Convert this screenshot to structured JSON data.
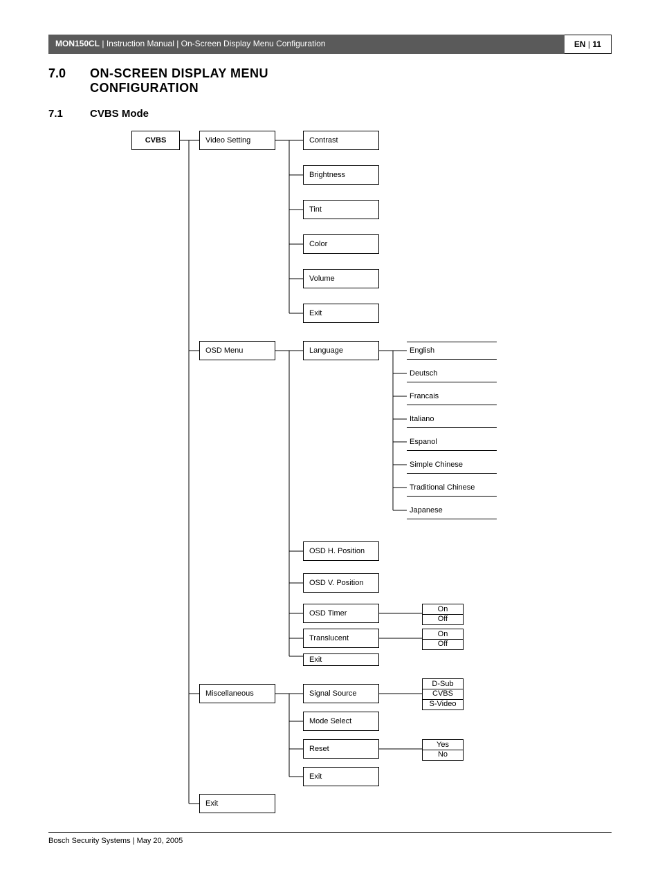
{
  "header": {
    "product": "MON150CL",
    "divider1": " | ",
    "doc_type": "Instruction Manual",
    "divider2": " | ",
    "section": "On-Screen Display Menu Configuration",
    "lang": "EN",
    "page_sep": " | ",
    "page_num": "11"
  },
  "title": {
    "num": "7.0",
    "text_line1": "ON-SCREEN DISPLAY MENU",
    "text_line2": "CONFIGURATION"
  },
  "subtitle": {
    "num": "7.1",
    "text": "CVBS Mode"
  },
  "nodes": {
    "cvbs": "CVBS",
    "video_setting": "Video Setting",
    "contrast": "Contrast",
    "brightness": "Brightness",
    "tint": "Tint",
    "color": "Color",
    "volume": "Volume",
    "exit1": "Exit",
    "osd_menu": "OSD Menu",
    "language": "Language",
    "english": "English",
    "deutsch": "Deutsch",
    "francais": "Francais",
    "italiano": "Italiano",
    "espanol": "Espanol",
    "simple_chinese": "Simple Chinese",
    "traditional_chinese": "Traditional Chinese",
    "japanese": "Japanese",
    "osd_h": "OSD H. Position",
    "osd_v": "OSD V. Position",
    "osd_timer": "OSD Timer",
    "translucent": "Translucent",
    "exit2": "Exit",
    "on1": "On",
    "off1": "Off",
    "on2": "On",
    "off2": "Off",
    "miscellaneous": "Miscellaneous",
    "signal_source": "Signal Source",
    "dsub": "D-Sub",
    "cvbs_opt": "CVBS",
    "svideo": "S-Video",
    "mode_select": "Mode Select",
    "reset": "Reset",
    "yes": "Yes",
    "no": "No",
    "exit3": "Exit",
    "exit4": "Exit"
  },
  "footer": {
    "text": "Bosch Security Systems | May 20, 2005"
  }
}
